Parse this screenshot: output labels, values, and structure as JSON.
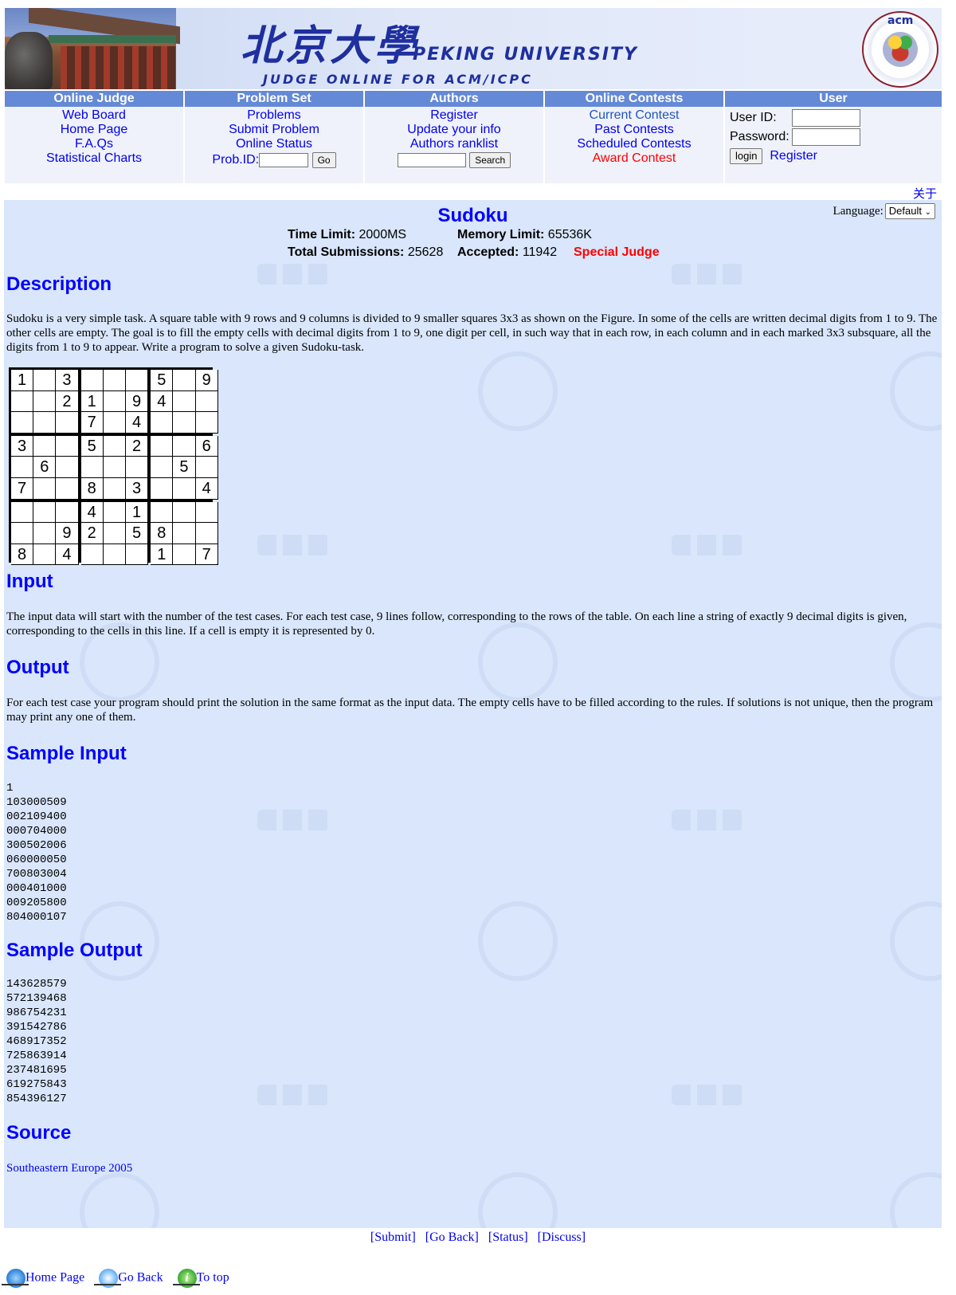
{
  "header": {
    "cn_title": "北京大學",
    "en_title": "PEKING UNIVERSITY",
    "sub_title": "JUDGE ONLINE FOR ACM/ICPC",
    "acm_logo_text": "acm"
  },
  "nav": {
    "online_judge": {
      "title": "Online Judge",
      "links": [
        "Web Board",
        "Home Page",
        "F.A.Qs",
        "Statistical Charts"
      ]
    },
    "problem_set": {
      "title": "Problem Set",
      "links": [
        "Problems",
        "Submit Problem",
        "Online Status"
      ],
      "prob_id_label": "Prob.ID:",
      "go_label": "Go"
    },
    "authors": {
      "title": "Authors",
      "links": [
        "Register",
        "Update your info",
        "Authors ranklist"
      ],
      "search_label": "Search"
    },
    "online_contests": {
      "title": "Online Contests",
      "links": [
        "Current Contest",
        "Past Contests",
        "Scheduled Contests",
        "Award Contest"
      ]
    },
    "user": {
      "title": "User",
      "user_id_label": "User ID:",
      "password_label": "Password:",
      "login_label": "login",
      "register_label": "Register"
    }
  },
  "about_link": "关于",
  "language": {
    "label": "Language:",
    "selected": "Default"
  },
  "problem": {
    "title": "Sudoku",
    "time_limit_label": "Time Limit:",
    "time_limit": "2000MS",
    "memory_limit_label": "Memory Limit:",
    "memory_limit": "65536K",
    "total_submissions_label": "Total Submissions:",
    "total_submissions": "25628",
    "accepted_label": "Accepted:",
    "accepted": "11942",
    "special_judge": "Special Judge"
  },
  "sections": {
    "description_h": "Description",
    "description": "Sudoku is a very simple task. A square table with 9 rows and 9 columns is divided to 9 smaller squares 3x3 as shown on the Figure. In some of the cells are written decimal digits from 1 to 9. The other cells are empty. The goal is to fill the empty cells with decimal digits from 1 to 9, one digit per cell, in such way that in each row, in each column and in each marked 3x3 subsquare, all the digits from 1 to 9 to appear. Write a program to solve a given Sudoku-task.",
    "input_h": "Input",
    "input": "The input data will start with the number of the test cases. For each test case, 9 lines follow, corresponding to the rows of the table. On each line a string of exactly 9 decimal digits is given, corresponding to the cells in this line. If a cell is empty it is represented by 0.",
    "output_h": "Output",
    "output": "For each test case your program should print the solution in the same format as the input data. The empty cells have to be filled according to the rules. If solutions is not unique, then the program may print any one of them.",
    "sample_input_h": "Sample Input",
    "sample_input": "1\n103000509\n002109400\n000704000\n300502006\n060000050\n700803004\n000401000\n009205800\n804000107",
    "sample_output_h": "Sample Output",
    "sample_output": "143628579\n572139468\n986754231\n391542786\n468917352\n725863914\n237481695\n619275843\n854396127",
    "source_h": "Source",
    "source": "Southeastern Europe 2005"
  },
  "sudoku_grid": [
    "1 3   5 9",
    "  21 94  ",
    "   7 4   ",
    "3  5 2  6",
    " 6     5 ",
    "7  8 3  4",
    "   4 1   ",
    "  92 58  ",
    "8 4   1 7"
  ],
  "footer": {
    "submit": "[Submit]",
    "go_back": "[Go Back]",
    "status": "[Status]",
    "discuss": "[Discuss]",
    "home_page": "Home Page",
    "go_back_nav": "Go Back",
    "to_top": "To top"
  },
  "colors": {
    "nav_header": "#6489d6",
    "content_bg": "#d9e6fb",
    "heading": "#0000ff",
    "special": "#ff0000"
  }
}
